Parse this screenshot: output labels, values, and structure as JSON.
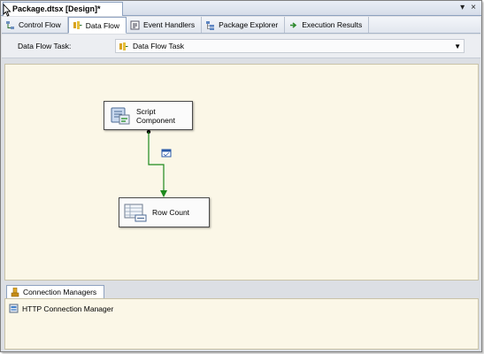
{
  "document": {
    "tab_title": "Package.dtsx [Design]*"
  },
  "window_buttons": {
    "dropdown": "▾",
    "close": "×"
  },
  "view_tabs": [
    {
      "label": "Control Flow",
      "icon": "control-flow-icon"
    },
    {
      "label": "Data Flow",
      "icon": "data-flow-icon"
    },
    {
      "label": "Event Handlers",
      "icon": "event-handlers-icon"
    },
    {
      "label": "Package Explorer",
      "icon": "package-explorer-icon"
    },
    {
      "label": "Execution Results",
      "icon": "execution-results-icon"
    }
  ],
  "active_tab": "Data Flow",
  "task_bar": {
    "label": "Data Flow Task:",
    "selected": "Data Flow Task"
  },
  "components": {
    "script": {
      "line1": "Script",
      "line2": "Component"
    },
    "row_count": {
      "label": "Row Count"
    }
  },
  "connection_managers": {
    "tab_label": "Connection Managers",
    "items": [
      {
        "label": "HTTP Connection Manager",
        "icon": "http-connection-icon"
      }
    ]
  },
  "colors": {
    "canvas_bg": "#fbf7e7",
    "connector": "#1d8a1d"
  }
}
